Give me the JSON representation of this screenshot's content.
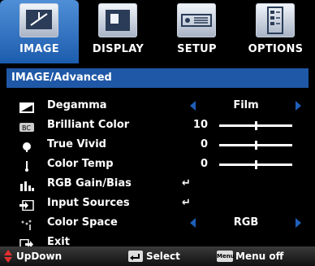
{
  "tabs": [
    {
      "label": "IMAGE",
      "icon": "image-tab-icon",
      "active": true
    },
    {
      "label": "DISPLAY",
      "icon": "display-tab-icon",
      "active": false
    },
    {
      "label": "SETUP",
      "icon": "setup-tab-icon",
      "active": false
    },
    {
      "label": "OPTIONS",
      "icon": "options-tab-icon",
      "active": false
    }
  ],
  "header": {
    "title": "IMAGE/Advanced"
  },
  "rows": [
    {
      "label": "Degamma",
      "icon": "degamma-icon",
      "control": "select",
      "value": "Film"
    },
    {
      "label": "Brilliant Color",
      "icon": "brilliant-color-icon",
      "control": "slider",
      "value": "10",
      "level": 0.5
    },
    {
      "label": "True Vivid",
      "icon": "true-vivid-icon",
      "control": "slider",
      "value": "0",
      "level": 0.5
    },
    {
      "label": "Color Temp",
      "icon": "color-temp-icon",
      "control": "slider",
      "value": "0",
      "level": 0.5
    },
    {
      "label": "RGB Gain/Bias",
      "icon": "rgb-gain-icon",
      "control": "enter",
      "value": "↵"
    },
    {
      "label": "Input Sources",
      "icon": "input-sources-icon",
      "control": "enter",
      "value": "↵"
    },
    {
      "label": "Color Space",
      "icon": "color-space-icon",
      "control": "select",
      "value": "RGB"
    },
    {
      "label": "Exit",
      "icon": "exit-icon",
      "control": "none",
      "value": ""
    }
  ],
  "footer": {
    "updown": "UpDown",
    "select": "Select",
    "menu_key": "Menu",
    "menu_off": "Menu off"
  },
  "colors": {
    "accent": "#1f58a6",
    "arrow": "#1e5fb8",
    "updown": "#e03030"
  }
}
